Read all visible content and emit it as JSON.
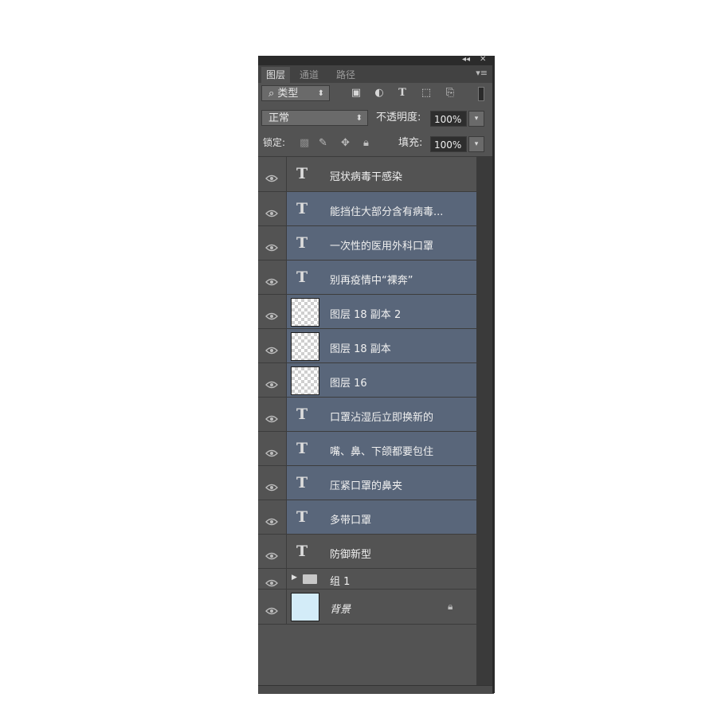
{
  "panel": {
    "controls": {
      "collapse": "◂◂",
      "close": "✕"
    },
    "tabs": [
      "图层",
      "通道",
      "路径"
    ],
    "menu_icon": "panel-menu-icon",
    "filter": {
      "search_icon": "⌕",
      "kind_label": "类型",
      "filter_icons": [
        "image-filter-icon",
        "adjustment-filter-icon",
        "type-filter-icon",
        "shape-filter-icon",
        "smart-object-filter-icon"
      ]
    },
    "blend": {
      "mode": "正常",
      "opacity_label": "不透明度:",
      "opacity_value": "100%"
    },
    "lock": {
      "label": "锁定:",
      "fill_label": "填充:",
      "fill_value": "100%"
    },
    "layers": [
      {
        "type": "text",
        "name": "冠状病毒干感染",
        "selected": false
      },
      {
        "type": "text",
        "name": "能挡住大部分含有病毒...",
        "selected": true
      },
      {
        "type": "text",
        "name": "一次性的医用外科口罩",
        "selected": true
      },
      {
        "type": "text",
        "name": "别再疫情中“裸奔”",
        "selected": true
      },
      {
        "type": "pixel",
        "name": "图层 18 副本 2",
        "selected": true
      },
      {
        "type": "pixel",
        "name": "图层 18 副本",
        "selected": true
      },
      {
        "type": "pixel",
        "name": "图层 16",
        "selected": true
      },
      {
        "type": "text",
        "name": "  口罩沾湿后立即换新的",
        "selected": true
      },
      {
        "type": "text",
        "name": " 嘴、鼻、下颌都要包住",
        "selected": true
      },
      {
        "type": "text",
        "name": "压紧口罩的鼻夹",
        "selected": true
      },
      {
        "type": "text",
        "name": "多带口罩",
        "selected": true
      },
      {
        "type": "text",
        "name": "防御新型",
        "selected": false
      },
      {
        "type": "group",
        "name": "组 1",
        "selected": false
      },
      {
        "type": "background",
        "name": "背景",
        "selected": false,
        "locked": true
      }
    ]
  }
}
